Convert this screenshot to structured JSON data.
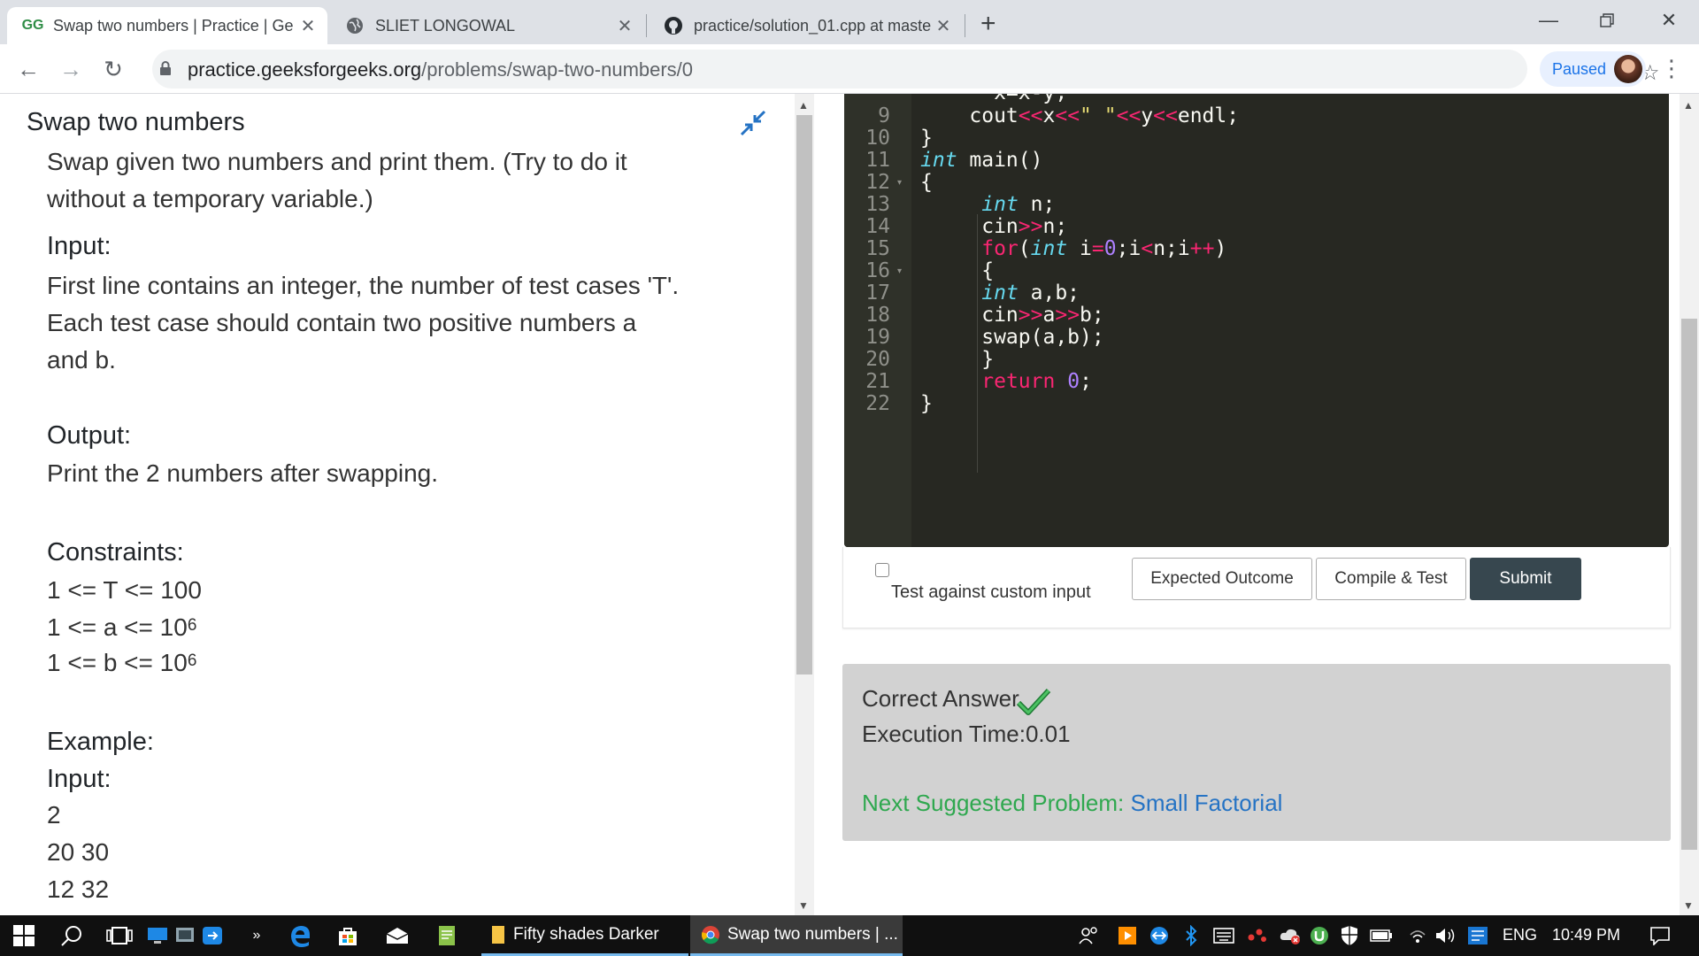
{
  "browser": {
    "tabs": [
      {
        "title": "Swap two numbers | Practice | Ge",
        "favicon": "GG"
      },
      {
        "title": "SLIET LONGOWAL",
        "favicon": "globe-icon"
      },
      {
        "title": "practice/solution_01.cpp at maste",
        "favicon": "github-icon"
      }
    ],
    "url_domain": "practice.geeksforgeeks.org",
    "url_path": "/problems/swap-two-numbers/0",
    "paused_label": "Paused"
  },
  "problem": {
    "title": "Swap two numbers",
    "description_line1": "Swap given two numbers and print them. (Try to do it",
    "description_line2": "without a temporary variable.)",
    "input_heading": "Input:",
    "input_line1": "First line contains an integer, the number of test cases 'T'.",
    "input_line2": "Each test case should contain two positive numbers a",
    "input_line3": "and b.",
    "output_heading": "Output:",
    "output_line1": "Print the 2 numbers after swapping.",
    "constraints_heading": "Constraints:",
    "constraint1": "1 <= T <= 100",
    "constraint2_base": "1 <= a <= 10",
    "constraint2_exp": "6",
    "constraint3_base": "1 <= b <= 10",
    "constraint3_exp": "6",
    "example_heading": "Example:",
    "example_input_heading": "Input:",
    "example_line1": "2",
    "example_line2": "20 30",
    "example_line3": "12 32"
  },
  "editor": {
    "line_numbers": [
      "9",
      "10",
      "11",
      "12",
      "13",
      "14",
      "15",
      "16",
      "17",
      "18",
      "19",
      "20",
      "21",
      "22"
    ],
    "partial_top_line": "x=x-y;"
  },
  "actions": {
    "custom_input_label": "Test against custom input",
    "expected_outcome": "Expected Outcome",
    "compile_test": "Compile & Test",
    "submit": "Submit"
  },
  "result": {
    "status": "Correct Answer.",
    "execution_time": "Execution Time:0.01",
    "next_label": "Next Suggested Problem: ",
    "next_problem": "Small Factorial"
  },
  "taskbar": {
    "app1": "Fifty shades Darker",
    "app2": "Swap two numbers | ...",
    "lang": "ENG",
    "time": "10:49 PM"
  },
  "colors": {
    "editor_bg": "#272822",
    "submit_bg": "#37474f",
    "result_bg": "#d2d2d2",
    "next_green": "#2fa84f",
    "link_blue": "#2573c4"
  }
}
